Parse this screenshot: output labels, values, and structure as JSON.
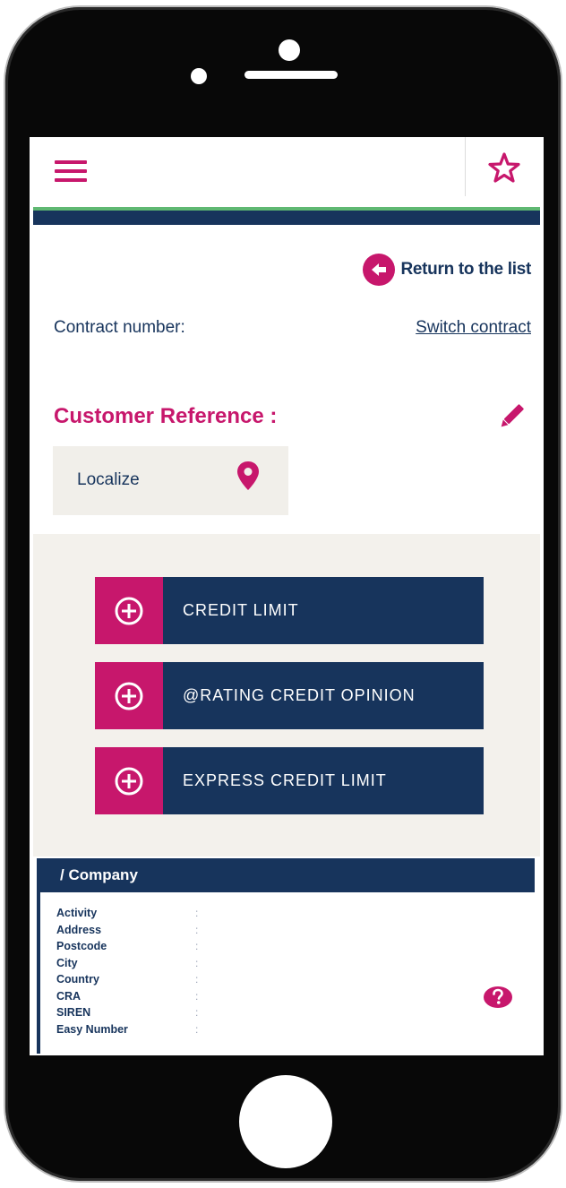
{
  "header": {
    "menu_icon": "hamburger-menu-icon",
    "favorite_icon": "star-outline-icon"
  },
  "navigation": {
    "return_label": "Return to the list",
    "return_icon": "arrow-left-circle-icon"
  },
  "contract": {
    "label": "Contract number:",
    "switch_label": "Switch contract"
  },
  "customer": {
    "reference_label": "Customer Reference :",
    "edit_icon": "pencil-icon",
    "localize_label": "Localize",
    "localize_icon": "map-pin-icon"
  },
  "actions": [
    {
      "label": "CREDIT LIMIT",
      "icon": "plus-circle-icon"
    },
    {
      "label": "@RATING CREDIT OPINION",
      "icon": "plus-circle-icon"
    },
    {
      "label": "EXPRESS CREDIT LIMIT",
      "icon": "plus-circle-icon"
    }
  ],
  "company": {
    "title": "/ Company",
    "separator": ":",
    "fields": [
      "Activity",
      "Address",
      "Postcode",
      "City",
      "Country",
      "CRA",
      "SIREN",
      "Easy Number"
    ],
    "help_icon": "question-icon"
  },
  "colors": {
    "magenta": "#c7176c",
    "navy": "#17345c",
    "green": "#5fb872",
    "beige": "#f3f1ec"
  }
}
